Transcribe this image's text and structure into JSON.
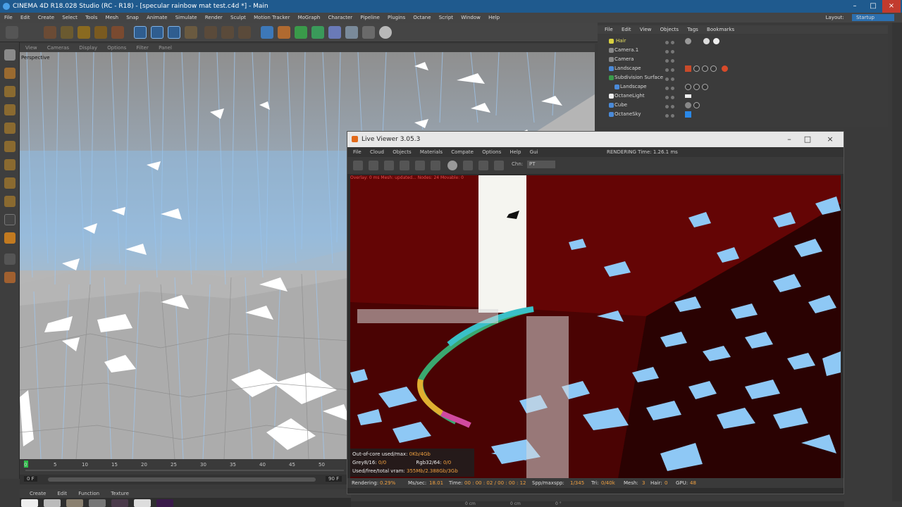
{
  "window": {
    "title": "CINEMA 4D R18.028 Studio (RC - R18) - [specular rainbow mat test.c4d *] - Main",
    "controls": [
      "–",
      "□",
      "×"
    ]
  },
  "menubar": {
    "items": [
      "File",
      "Edit",
      "Create",
      "Select",
      "Tools",
      "Mesh",
      "Snap",
      "Animate",
      "Simulate",
      "Render",
      "Sculpt",
      "Motion Tracker",
      "MoGraph",
      "Character",
      "Pipeline",
      "Plugins",
      "Octane",
      "Script",
      "Window",
      "Help"
    ],
    "layout_label": "Layout:",
    "layout_value": "Startup"
  },
  "viewport": {
    "menu": [
      "View",
      "Cameras",
      "Display",
      "Options",
      "Filter",
      "Panel"
    ],
    "label": "Perspective"
  },
  "timeline": {
    "ticks": [
      "0",
      "5",
      "10",
      "15",
      "20",
      "25",
      "30",
      "35",
      "40",
      "45",
      "50"
    ],
    "start_frame": "0 F",
    "end_frame": "90 F"
  },
  "material_manager": {
    "menu": [
      "Create",
      "Edit",
      "Function",
      "Texture"
    ]
  },
  "object_manager": {
    "menu": [
      "File",
      "Edit",
      "View",
      "Objects",
      "Tags",
      "Bookmarks"
    ],
    "objects": [
      {
        "name": "Hair",
        "color": "#d8d040"
      },
      {
        "name": "Camera.1",
        "color": "#cfcfcf"
      },
      {
        "name": "Camera",
        "color": "#cfcfcf"
      },
      {
        "name": "Landscape",
        "color": "#cfcfcf"
      },
      {
        "name": "Subdivision Surface",
        "color": "#cfcfcf"
      },
      {
        "name": "Landscape",
        "color": "#cfcfcf"
      },
      {
        "name": "OctaneLight",
        "color": "#cfcfcf"
      },
      {
        "name": "Cube",
        "color": "#cfcfcf"
      },
      {
        "name": "OctaneSky",
        "color": "#cfcfcf"
      }
    ]
  },
  "live_viewer": {
    "title": "Live Viewer 3.05.3",
    "menu": [
      "File",
      "Cloud",
      "Objects",
      "Materials",
      "Compate",
      "Options",
      "Help",
      "Gui"
    ],
    "status_text": "RENDERING  Time: 1.26.1 ms",
    "overlay_top": "Overlay: 0 ms  Mesh: updated...  Nodes: 24  Movable: 0",
    "channel_label": "Chn:",
    "channel_value": "PT",
    "out_of_core": {
      "line1_label": "Out-of-core used/max:",
      "line1_value": "0Kb/4Gb",
      "line2_label": "Grey8/16:",
      "line2_value": "0/0",
      "line2b_label": "Rgb32/64:",
      "line2b_value": "0/0",
      "line3_label": "Used/free/total vram:",
      "line3_value": "355Mb/2.388Gb/3Gb"
    },
    "footer": {
      "rendering_label": "Rendering:",
      "rendering_value": "0.29%",
      "mssec_label": "Ms/sec:",
      "mssec_value": "18.01",
      "time_label": "Time:",
      "time_value": "00 : 00 : 02 / 00 : 00 : 12",
      "spp_label": "Spp/maxspp:",
      "spp_value": "1/345",
      "tri_label": "Tri:",
      "tri_value": "0/40k",
      "mesh_label": "Mesh:",
      "mesh_value": "3",
      "hair_label": "Hair:",
      "hair_value": "0",
      "gpu_label": "GPU:",
      "gpu_value": "48"
    }
  },
  "coords": {
    "x": "0 cm",
    "y": "0 cm",
    "h": "0 °"
  }
}
